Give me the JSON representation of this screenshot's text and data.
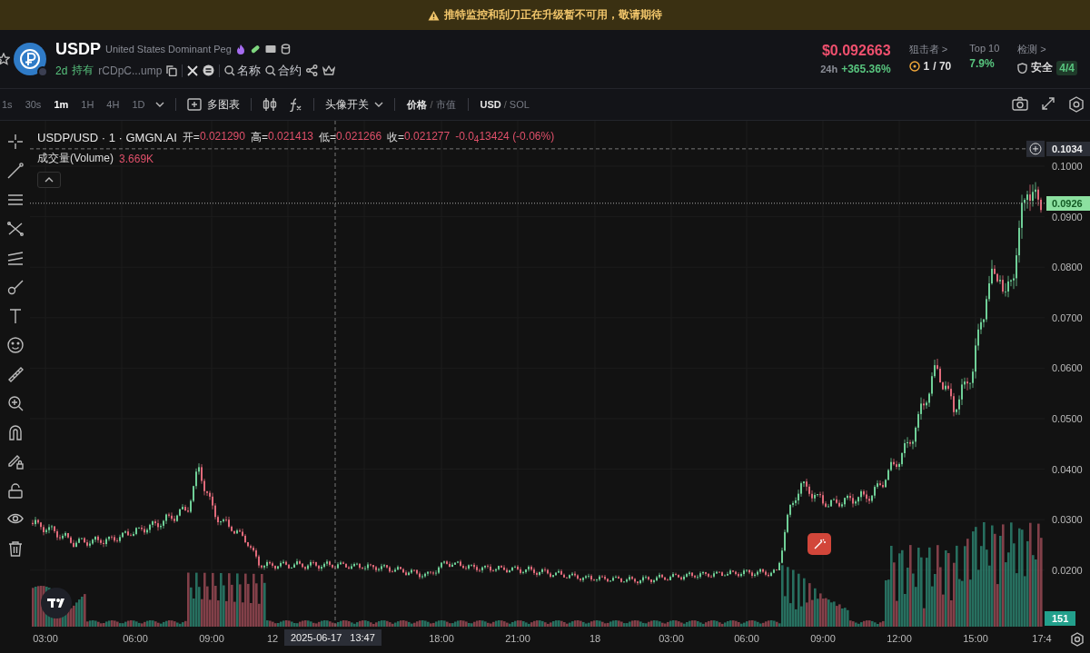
{
  "banner": {
    "text": "推特监控和刮刀正在升级暂不可用，敬请期待"
  },
  "token": {
    "symbol": "USDP",
    "name": "United States Dominant Peg",
    "age": "2d",
    "holders_label": "持有",
    "address": "rCDpC...ump",
    "search_links": [
      "名称",
      "合约"
    ]
  },
  "stats": [
    {
      "kind": "price",
      "value": "$0.092663",
      "label": "24h",
      "change": "+365.36%"
    },
    {
      "kind": "snipers",
      "label": "狙击者 >",
      "value": "1",
      "total": "/ 70"
    },
    {
      "kind": "top",
      "label": "Top 10",
      "value": "7.9%"
    },
    {
      "kind": "audit",
      "label": "检测 >",
      "value": "安全",
      "badge": "4/4"
    }
  ],
  "toolbar": {
    "intervals": [
      {
        "label": "1s",
        "selected": false
      },
      {
        "label": "30s",
        "selected": false
      },
      {
        "label": "1m",
        "selected": true
      },
      {
        "label": "1H",
        "selected": false
      },
      {
        "label": "4H",
        "selected": false
      },
      {
        "label": "1D",
        "selected": false
      }
    ],
    "multi_chart": "多图表",
    "avatar_toggle": "头像开关",
    "separator": "/",
    "price_mode": [
      {
        "label": "价格",
        "selected": true
      },
      {
        "label": "市值",
        "selected": false
      }
    ],
    "currency": [
      {
        "label": "USD",
        "selected": true
      },
      {
        "label": "SOL",
        "selected": false
      }
    ]
  },
  "legend": {
    "title": "USDP/USD · 1 · GMGN.AI",
    "ohlc": [
      {
        "label": "开=",
        "value": "0.021290"
      },
      {
        "label": "高=",
        "value": "0.021413"
      },
      {
        "label": "低=",
        "value": "0.021266"
      },
      {
        "label": "收=",
        "value": "0.021277"
      }
    ],
    "change": "-0.0$_{4}$13424 (-0.06%)"
  },
  "volume": {
    "label": "成交量(Volume)",
    "value": "3.669K"
  },
  "price_axis": {
    "labels": [
      "0.1000",
      "0.0900",
      "0.0800",
      "0.0700",
      "0.0600",
      "0.0500",
      "0.0400",
      "0.0300",
      "0.0200"
    ],
    "crosshair": "0.1034",
    "current": "0.0926",
    "volume_badge": "151"
  },
  "time_axis": {
    "labels": [
      "03:00",
      "06:00",
      "09:00",
      "12",
      "18:00",
      "21:00",
      "18",
      "03:00",
      "06:00",
      "09:00",
      "12:00",
      "15:00",
      "17:4"
    ],
    "crosshair_date": "2025-06-17",
    "crosshair_time": "13:47"
  }
}
